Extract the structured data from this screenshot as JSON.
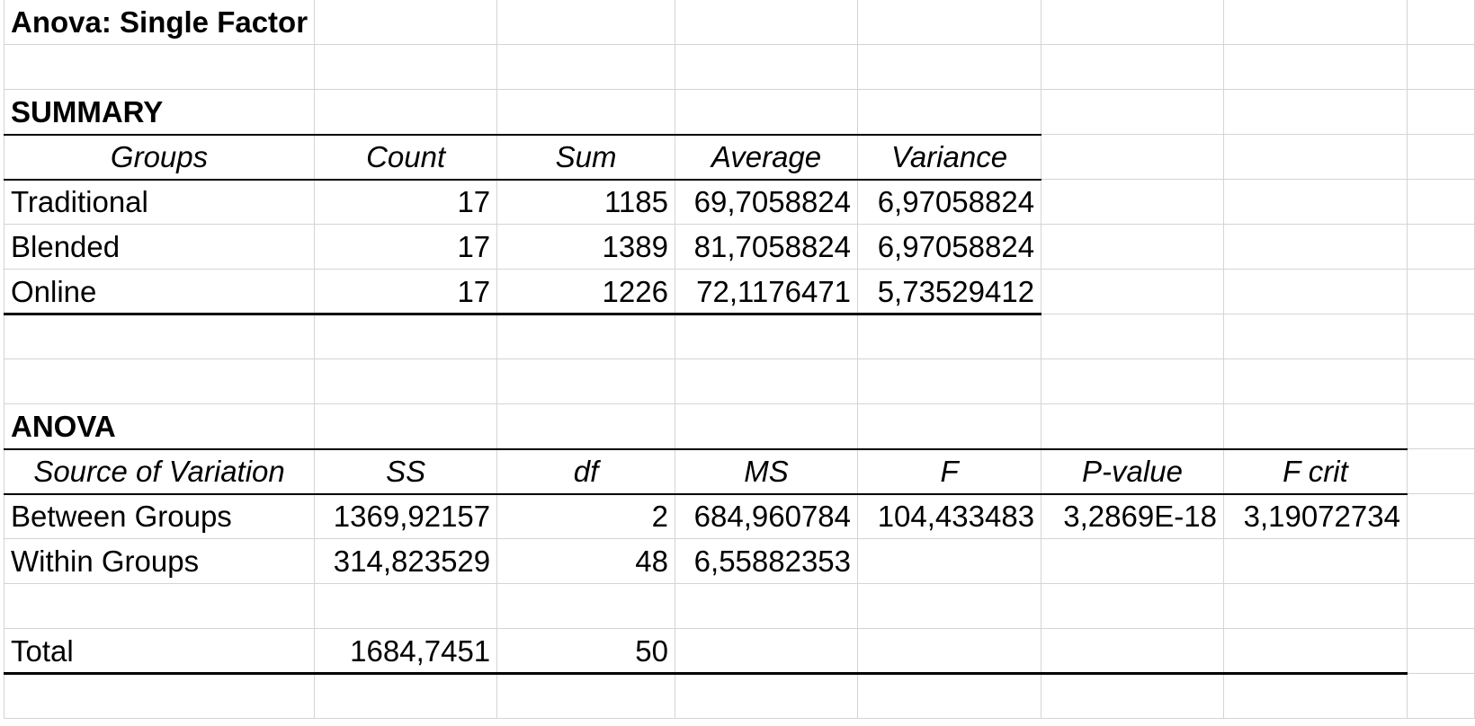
{
  "title": "Anova: Single Factor",
  "summary": {
    "heading": "SUMMARY",
    "headers": [
      "Groups",
      "Count",
      "Sum",
      "Average",
      "Variance"
    ],
    "rows": [
      [
        "Traditional",
        "17",
        "1185",
        "69,7058824",
        "6,97058824"
      ],
      [
        "Blended",
        "17",
        "1389",
        "81,7058824",
        "6,97058824"
      ],
      [
        "Online",
        "17",
        "1226",
        "72,1176471",
        "5,73529412"
      ]
    ]
  },
  "anova": {
    "heading": "ANOVA",
    "headers": [
      "Source of Variation",
      "SS",
      "df",
      "MS",
      "F",
      "P-value",
      "F crit"
    ],
    "rows": [
      [
        "Between Groups",
        "1369,92157",
        "2",
        "684,960784",
        "104,433483",
        "3,2869E-18",
        "3,19072734"
      ],
      [
        "Within Groups",
        "314,823529",
        "48",
        "6,55882353",
        "",
        "",
        ""
      ]
    ],
    "total": [
      "Total",
      "1684,7451",
      "50",
      "",
      "",
      "",
      ""
    ]
  },
  "colors": {
    "gridline": "#d4d4d4",
    "border": "#000000",
    "background": "#ffffff"
  }
}
